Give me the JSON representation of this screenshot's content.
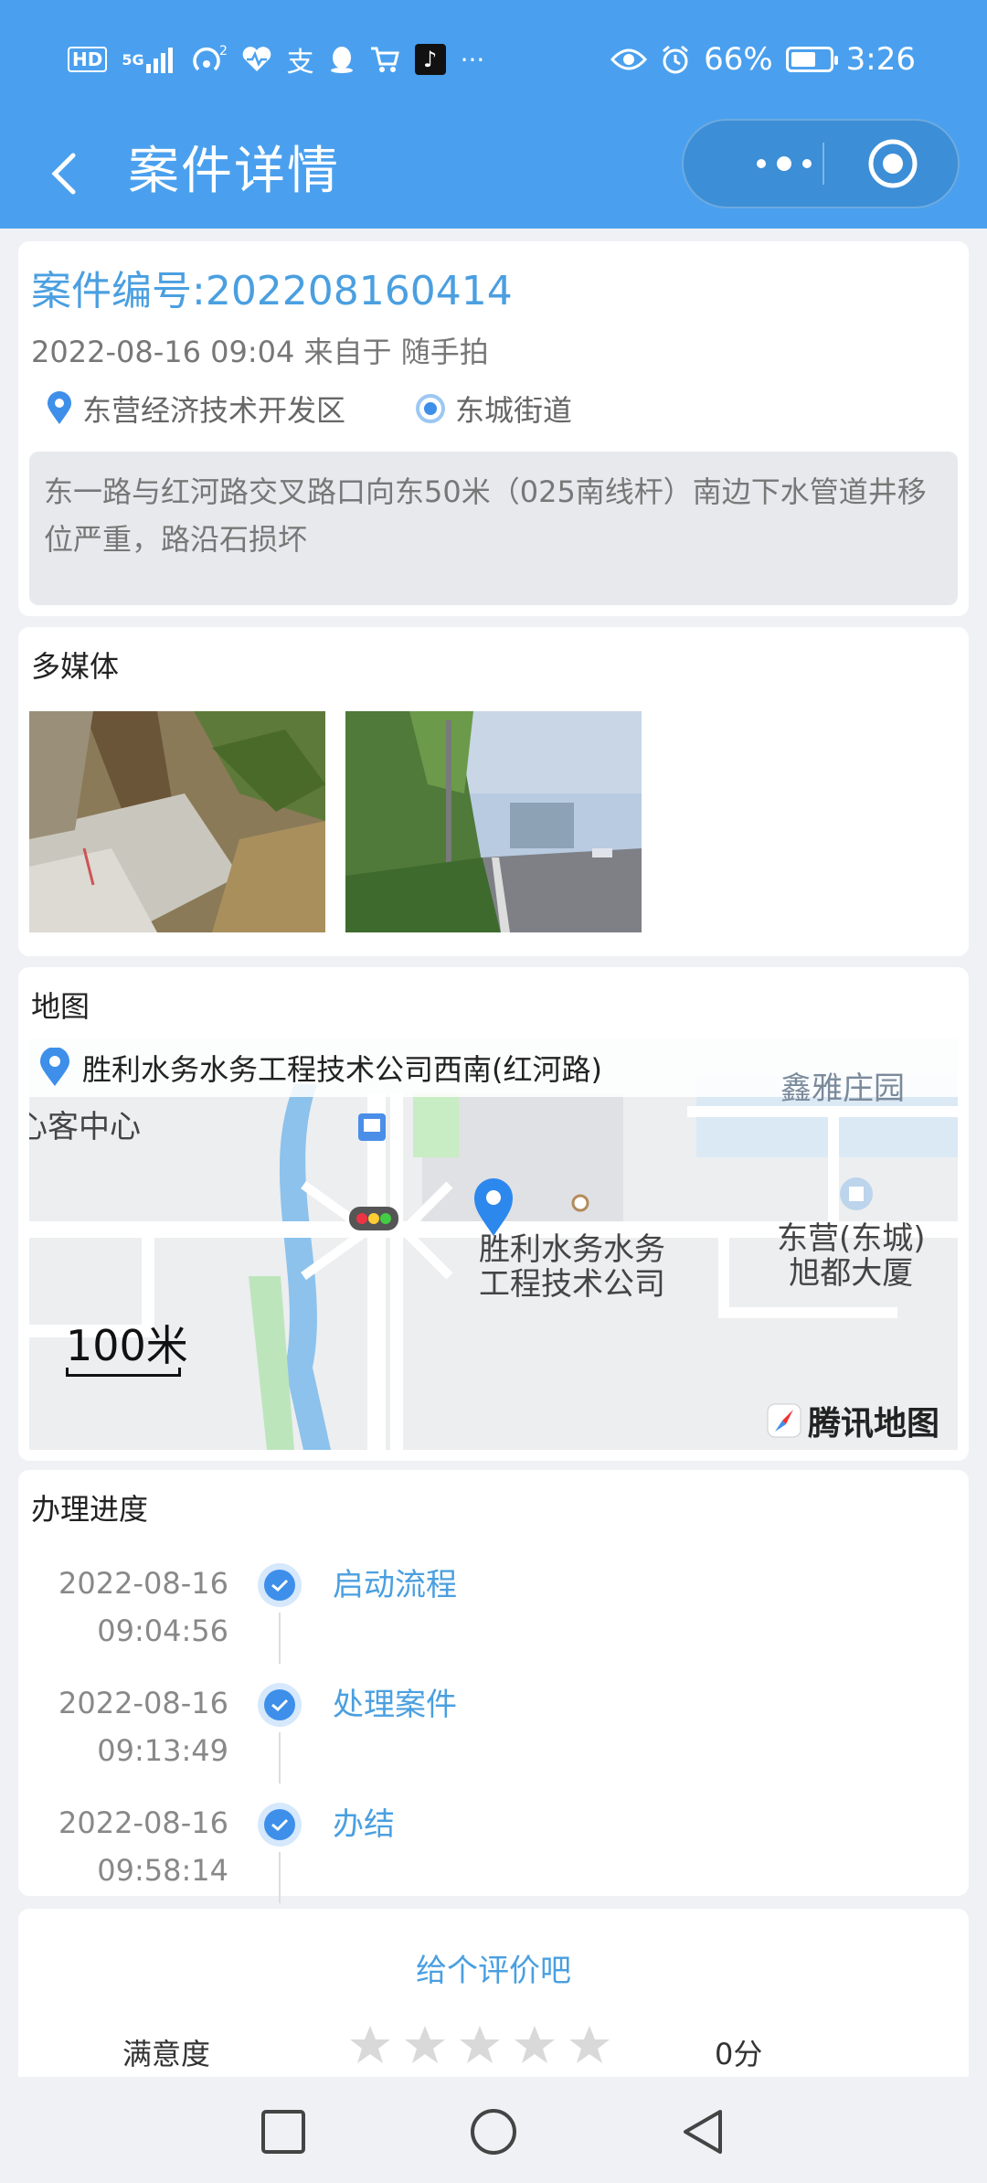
{
  "status_bar": {
    "hd": "HD",
    "network": "5G",
    "battery_percent": "66%",
    "time": "3:26",
    "battery_level": 0.66
  },
  "nav": {
    "title": "案件详情"
  },
  "case": {
    "number_label": "案件编号:202208160414",
    "datetime": "2022-08-16 09:04",
    "source_prefix": "来自于",
    "source": "随手拍",
    "district": "东营经济技术开发区",
    "street": "东城街道",
    "description": "东一路与红河路交叉路口向东50米（025南线杆）南边下水管道井移位严重，路沿石损坏"
  },
  "media": {
    "title": "多媒体"
  },
  "map": {
    "title": "地图",
    "address": "胜利水务水务工程技术公司西南(红河路)",
    "labels": {
      "left": "心客中心",
      "marker_line1": "胜利水务水务",
      "marker_line2": "工程技术公司",
      "right_line1": "东营(东城)",
      "right_line2": "旭都大厦",
      "top": "鑫雅庄园"
    },
    "scale": "100米",
    "logo": "腾讯地图"
  },
  "progress": {
    "title": "办理进度",
    "steps": [
      {
        "date": "2022-08-16",
        "time": "09:04:56",
        "label": "启动流程"
      },
      {
        "date": "2022-08-16",
        "time": "09:13:49",
        "label": "处理案件"
      },
      {
        "date": "2022-08-16",
        "time": "09:58:14",
        "label": "办结"
      }
    ]
  },
  "rating": {
    "prompt": "给个评价吧",
    "label": "满意度",
    "stars_filled": 0,
    "stars_total": 5,
    "score": "0分"
  },
  "colors": {
    "primary": "#4aa0ee",
    "link": "#4a9fe0",
    "check": "#3d8fea"
  }
}
